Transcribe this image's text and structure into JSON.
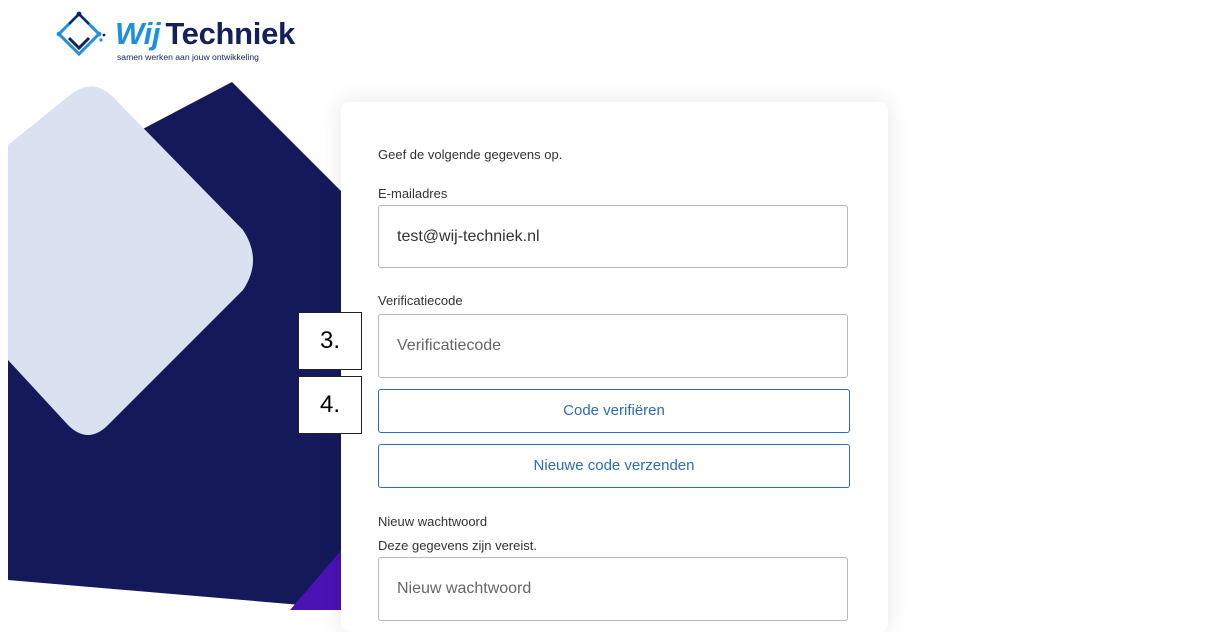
{
  "logo": {
    "brand_first": "Wij",
    "brand_second": "Techniek",
    "tagline": "samen werken aan jouw ontwikkeling",
    "colors": {
      "navy": "#14205a",
      "blue": "#1e8fe1"
    }
  },
  "form": {
    "intro": "Geef de volgende gegevens op.",
    "email_label": "E-mailadres",
    "email_value": "test@wij-techniek.nl",
    "code_label": "Verificatiecode",
    "code_placeholder": "Verificatiecode",
    "verify_button": "Code verifiëren",
    "resend_button": "Nieuwe code verzenden",
    "new_password_label": "Nieuw wachtwoord",
    "required_note": "Deze gegevens zijn vereist.",
    "new_password_placeholder": "Nieuw wachtwoord"
  },
  "markers": {
    "step3": "3.",
    "step4": "4."
  },
  "colors": {
    "accent": "#2c6cb8",
    "shape_light": "#dae2f2",
    "shape_dark": "#14195a",
    "shape_purple": "#4b12b4"
  }
}
